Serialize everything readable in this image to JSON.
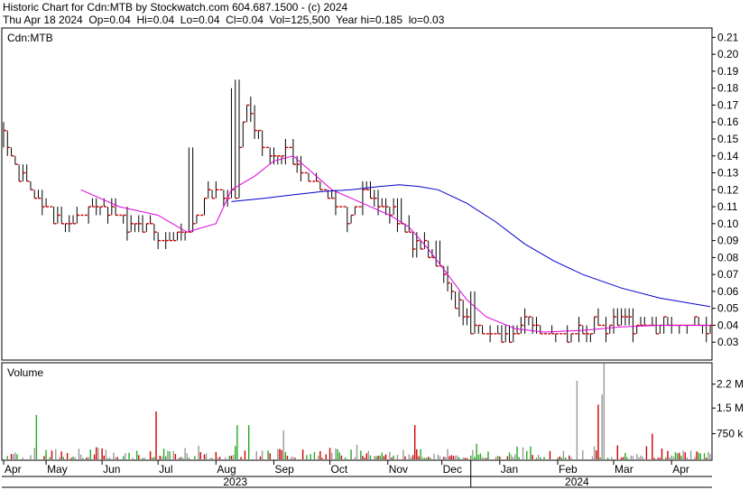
{
  "header": {
    "line1": "Historic Chart for Cdn:MTB by Stockwatch.com 604.687.1500 - (c) 2024",
    "line2": "Thu Apr 18 2024  Op=0.04  Hi=0.04  Lo=0.04  Cl=0.04  Vol=125,500  Year hi=0.185  lo=0.03"
  },
  "colors": {
    "price_bar": "#000000",
    "close_tick": "#cc0000",
    "ma_short": "#dd00dd",
    "ma_long": "#0000cc",
    "volume_up": "#22aa22",
    "volume_down": "#cc0000",
    "volume_flat": "#999999",
    "background": "#ffffff"
  },
  "chart_data": [
    {
      "type": "line",
      "panel": "price",
      "title": "Cdn:MTB",
      "ylim": [
        0.02,
        0.215
      ],
      "yticks": [
        0.21,
        0.2,
        0.19,
        0.18,
        0.17,
        0.16,
        0.15,
        0.14,
        0.13,
        0.12,
        0.11,
        0.1,
        0.09,
        0.08,
        0.07,
        0.06,
        0.05,
        0.04,
        0.03
      ],
      "ytick_labels": [
        "0.21",
        "0.20",
        "0.19",
        "0.18",
        "0.17",
        "0.16",
        "0.15",
        "0.14",
        "0.13",
        "0.12",
        "0.11",
        "0.10",
        "0.09",
        "0.08",
        "0.07",
        "0.06",
        "0.05",
        "0.04",
        "0.03"
      ],
      "grid": false,
      "ohlc_anchor_days": [
        0,
        3,
        8,
        14,
        20,
        28,
        35,
        45,
        55,
        66,
        76,
        86,
        94,
        98,
        102,
        110,
        114,
        120,
        124,
        127,
        130,
        137,
        142,
        148,
        155,
        165,
        172,
        180,
        188,
        196,
        205,
        212,
        220,
        228,
        235,
        243,
        250,
        256,
        262,
        272,
        282,
        292,
        300,
        310,
        320,
        330,
        340,
        350,
        360,
        366
      ],
      "ohlc_anchor_close": [
        0.15,
        0.14,
        0.13,
        0.12,
        0.11,
        0.105,
        0.1,
        0.11,
        0.11,
        0.1,
        0.095,
        0.09,
        0.095,
        0.1,
        0.11,
        0.12,
        0.115,
        0.12,
        0.16,
        0.17,
        0.16,
        0.14,
        0.14,
        0.14,
        0.13,
        0.12,
        0.11,
        0.105,
        0.115,
        0.11,
        0.1,
        0.09,
        0.08,
        0.07,
        0.055,
        0.04,
        0.035,
        0.035,
        0.035,
        0.04,
        0.035,
        0.035,
        0.035,
        0.04,
        0.045,
        0.04,
        0.04,
        0.04,
        0.04,
        0.04
      ],
      "ohlc_spikes": [
        {
          "day": 97,
          "high": 0.145
        },
        {
          "day": 118,
          "high": 0.18
        },
        {
          "day": 121,
          "high": 0.185
        },
        {
          "day": 148,
          "high": 0.145
        },
        {
          "day": 205,
          "high": 0.115
        },
        {
          "day": 210,
          "high": 0.105
        },
        {
          "day": 225,
          "high": 0.09
        },
        {
          "day": 243,
          "high": 0.06
        }
      ],
      "series": [
        {
          "key": "ma_short",
          "days": [
            40,
            60,
            80,
            95,
            110,
            118,
            130,
            140,
            150,
            160,
            170,
            180,
            190,
            200,
            210,
            220,
            230,
            240,
            250,
            265,
            280,
            300,
            320,
            340,
            366
          ],
          "values": [
            0.12,
            0.11,
            0.105,
            0.095,
            0.1,
            0.12,
            0.128,
            0.137,
            0.14,
            0.13,
            0.12,
            0.115,
            0.11,
            0.105,
            0.098,
            0.085,
            0.07,
            0.055,
            0.045,
            0.038,
            0.036,
            0.037,
            0.039,
            0.04,
            0.04
          ]
        },
        {
          "key": "ma_long",
          "days": [
            118,
            135,
            150,
            165,
            180,
            195,
            205,
            215,
            225,
            240,
            255,
            270,
            285,
            300,
            320,
            340,
            366
          ],
          "values": [
            0.113,
            0.115,
            0.117,
            0.119,
            0.12,
            0.122,
            0.123,
            0.122,
            0.12,
            0.112,
            0.101,
            0.088,
            0.078,
            0.07,
            0.062,
            0.056,
            0.051
          ]
        }
      ]
    },
    {
      "type": "bar",
      "panel": "volume",
      "title": "Volume",
      "ylim": [
        0,
        2800000
      ],
      "yticks": [
        2200000,
        1500000,
        750000
      ],
      "ytick_labels": [
        "2.2 M",
        "1.5 M",
        "750 k"
      ],
      "big_bars": [
        {
          "day": 17,
          "value": 1300000,
          "dir": "up"
        },
        {
          "day": 79,
          "value": 1400000,
          "dir": "down"
        },
        {
          "day": 121,
          "value": 1000000,
          "dir": "up"
        },
        {
          "day": 127,
          "value": 1000000,
          "dir": "up"
        },
        {
          "day": 145,
          "value": 850000,
          "dir": "flat"
        },
        {
          "day": 213,
          "value": 1000000,
          "dir": "down"
        },
        {
          "day": 297,
          "value": 2300000,
          "dir": "flat"
        },
        {
          "day": 310,
          "value": 1900000,
          "dir": "flat"
        },
        {
          "day": 308,
          "value": 1600000,
          "dir": "down"
        },
        {
          "day": 311,
          "value": 2800000,
          "dir": "flat"
        },
        {
          "day": 336,
          "value": 750000,
          "dir": "down"
        }
      ]
    }
  ],
  "x_axis": {
    "day_range": [
      0,
      366
    ],
    "months": [
      {
        "label": "Apr",
        "day": 0
      },
      {
        "label": "May",
        "day": 22
      },
      {
        "label": "Jun",
        "day": 51
      },
      {
        "label": "Jul",
        "day": 80
      },
      {
        "label": "Aug",
        "day": 110
      },
      {
        "label": "Sep",
        "day": 140
      },
      {
        "label": "Oct",
        "day": 169
      },
      {
        "label": "Nov",
        "day": 199
      },
      {
        "label": "Dec",
        "day": 227
      },
      {
        "label": "Jan",
        "day": 257
      },
      {
        "label": "Feb",
        "day": 287
      },
      {
        "label": "Mar",
        "day": 316
      },
      {
        "label": "Apr",
        "day": 346
      }
    ],
    "years": [
      {
        "label": "2023",
        "day": 120
      },
      {
        "label": "2024",
        "day": 297
      }
    ],
    "year_divider_day": 242
  }
}
